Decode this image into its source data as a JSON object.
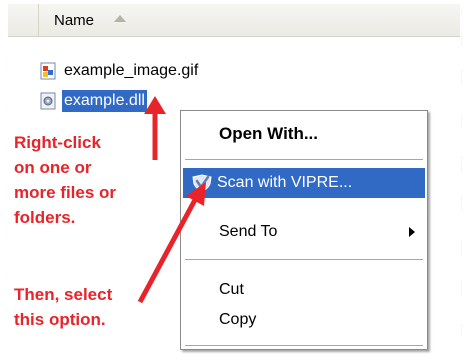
{
  "explorer": {
    "header": {
      "name_column": "Name"
    },
    "files": [
      {
        "name": "example_image.gif",
        "icon": "gif-image-icon"
      },
      {
        "name": "example.dll",
        "icon": "dll-file-icon",
        "selected": true
      }
    ]
  },
  "context_menu": {
    "items": [
      {
        "label": "Open With...",
        "bold": true
      },
      {
        "label": "Scan with VIPRE...",
        "highlighted": true,
        "icon": "vipre-shield-icon"
      },
      {
        "label": "Send To",
        "submenu": true
      },
      {
        "label": "Cut"
      },
      {
        "label": "Copy"
      }
    ]
  },
  "annotations": {
    "step1": "Right-click\non one or\nmore files or\nfolders.",
    "step2": "Then, select\nthis option."
  },
  "colors": {
    "selection": "#316ac5",
    "annotation_red": "#e8242a",
    "header_bg": "#ebeae4"
  }
}
